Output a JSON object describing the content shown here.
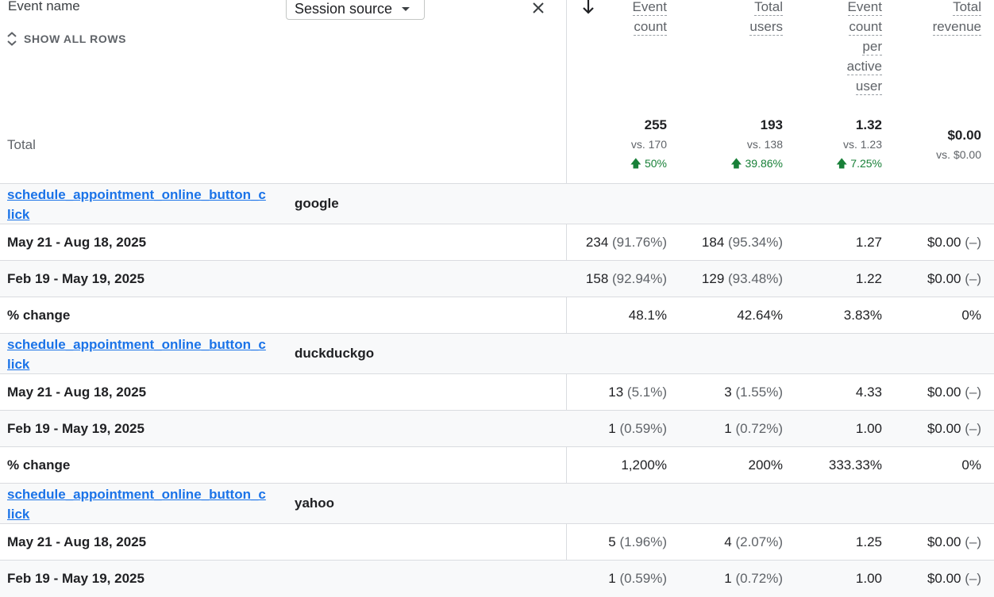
{
  "header": {
    "dimension_title": "Event name",
    "show_all_rows": "SHOW ALL ROWS",
    "secondary_dimension": "Session source"
  },
  "metrics": [
    {
      "label": "Event count",
      "lines": [
        "Event",
        "count"
      ]
    },
    {
      "label": "Total users",
      "lines": [
        "Total",
        "users"
      ]
    },
    {
      "label": "Event count per active user",
      "lines": [
        "Event",
        "count",
        "per",
        "active",
        "user"
      ]
    },
    {
      "label": "Total revenue",
      "lines": [
        "Total",
        "revenue"
      ]
    }
  ],
  "totals": {
    "label": "Total",
    "event_count": {
      "value": "255",
      "vs": "vs. 170",
      "change": "50%"
    },
    "total_users": {
      "value": "193",
      "vs": "vs. 138",
      "change": "39.86%"
    },
    "per_user": {
      "value": "1.32",
      "vs": "vs. 1.23",
      "change": "7.25%"
    },
    "revenue": {
      "value": "$0.00",
      "vs": "vs. $0.00"
    }
  },
  "groups": [
    {
      "event": "schedule_appointment_online_button_click",
      "source": "google",
      "rows": [
        {
          "label": "May 21 - Aug 18, 2025",
          "event_count": "234",
          "event_count_pct": "(91.76%)",
          "users": "184",
          "users_pct": "(95.34%)",
          "per_user": "1.27",
          "revenue": "$0.00",
          "revenue_pct": "(–)"
        },
        {
          "label": "Feb 19 - May 19, 2025",
          "event_count": "158",
          "event_count_pct": "(92.94%)",
          "users": "129",
          "users_pct": "(93.48%)",
          "per_user": "1.22",
          "revenue": "$0.00",
          "revenue_pct": "(–)"
        },
        {
          "label": "% change",
          "event_count": "48.1%",
          "event_count_pct": "",
          "users": "42.64%",
          "users_pct": "",
          "per_user": "3.83%",
          "revenue": "0%",
          "revenue_pct": ""
        }
      ]
    },
    {
      "event": "schedule_appointment_online_button_click",
      "source": "duckduckgo",
      "rows": [
        {
          "label": "May 21 - Aug 18, 2025",
          "event_count": "13",
          "event_count_pct": "(5.1%)",
          "users": "3",
          "users_pct": "(1.55%)",
          "per_user": "4.33",
          "revenue": "$0.00",
          "revenue_pct": "(–)"
        },
        {
          "label": "Feb 19 - May 19, 2025",
          "event_count": "1",
          "event_count_pct": "(0.59%)",
          "users": "1",
          "users_pct": "(0.72%)",
          "per_user": "1.00",
          "revenue": "$0.00",
          "revenue_pct": "(–)"
        },
        {
          "label": "% change",
          "event_count": "1,200%",
          "event_count_pct": "",
          "users": "200%",
          "users_pct": "",
          "per_user": "333.33%",
          "revenue": "0%",
          "revenue_pct": ""
        }
      ]
    },
    {
      "event": "schedule_appointment_online_button_click",
      "source": "yahoo",
      "rows": [
        {
          "label": "May 21 - Aug 18, 2025",
          "event_count": "5",
          "event_count_pct": "(1.96%)",
          "users": "4",
          "users_pct": "(2.07%)",
          "per_user": "1.25",
          "revenue": "$0.00",
          "revenue_pct": "(–)"
        },
        {
          "label": "Feb 19 - May 19, 2025",
          "event_count": "1",
          "event_count_pct": "(0.59%)",
          "users": "1",
          "users_pct": "(0.72%)",
          "per_user": "1.00",
          "revenue": "$0.00",
          "revenue_pct": "(–)"
        }
      ]
    }
  ]
}
